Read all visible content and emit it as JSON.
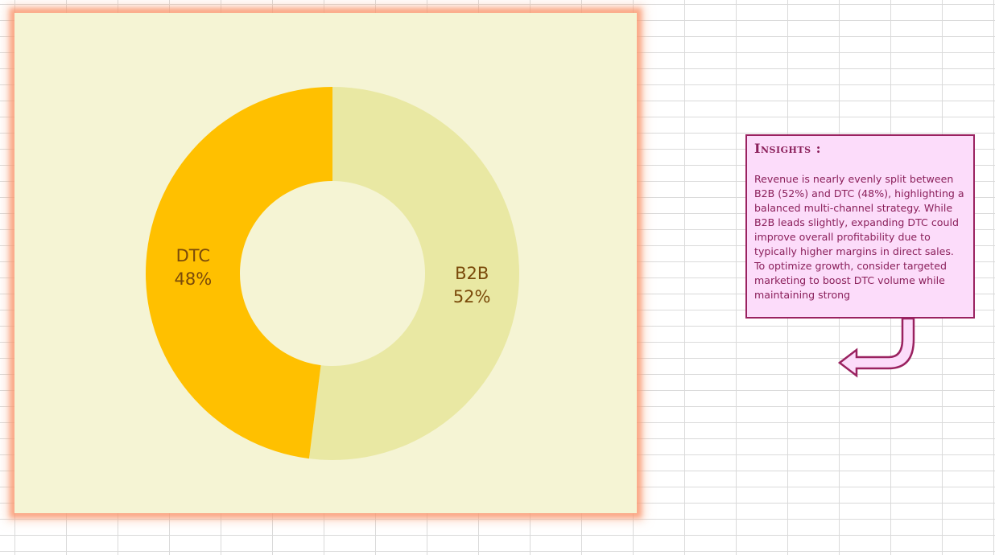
{
  "chart_data": {
    "type": "pie",
    "variant": "doughnut",
    "categories": [
      "B2B",
      "DTC"
    ],
    "values": [
      52,
      48
    ],
    "data_labels": [
      {
        "category": "B2B",
        "value_label": "52%"
      },
      {
        "category": "DTC",
        "value_label": "48%"
      }
    ],
    "colors": [
      "#e9e8a3",
      "#ffc000"
    ],
    "start_angle_deg": 0,
    "direction": "clockwise",
    "legend": "none",
    "plot_background": "#f5f4d4",
    "glow_color": "#f9a37e"
  },
  "insights": {
    "title": "Insights :",
    "body": "Revenue is nearly evenly split between B2B (52%) and DTC (48%), highlighting a balanced multi-channel strategy. While B2B leads slightly, expanding DTC could improve overall profitability due to typically higher margins in direct sales. To optimize growth, consider targeted marketing to boost DTC volume while maintaining strong",
    "fill_color": "#fcdcfa",
    "border_color": "#9a2260",
    "arrow_icon": "u-turn-arrow-left-icon"
  }
}
